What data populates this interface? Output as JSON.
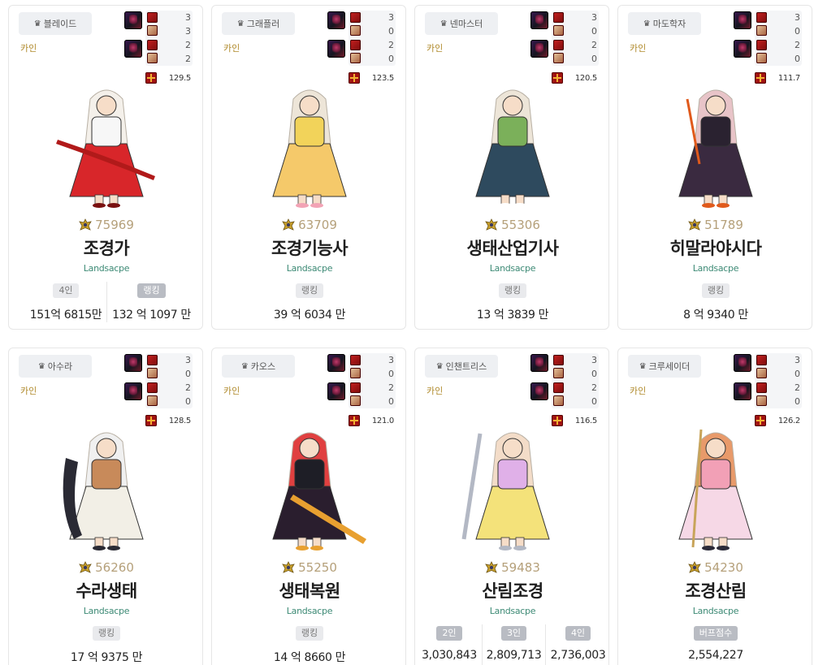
{
  "cards": [
    {
      "class_name": "블레이드",
      "server": "카인",
      "slots": [
        "3",
        "3",
        "2",
        "2"
      ],
      "score": "129.5",
      "fame": "75969",
      "name": "조경가",
      "guild": "Landsacpe",
      "stats": [
        {
          "label": "4인",
          "value": "151억 6815만",
          "style": "light"
        },
        {
          "label": "랭킹",
          "value": "132 억 1097 만",
          "style": "dark"
        }
      ],
      "palette": {
        "hair": "#f4f0ea",
        "top": "#f7f7f7",
        "skirt": "#d8262a",
        "accent": "#7a1010"
      }
    },
    {
      "class_name": "그래플러",
      "server": "카인",
      "slots": [
        "3",
        "0",
        "2",
        "0"
      ],
      "score": "123.5",
      "fame": "63709",
      "name": "조경기능사",
      "guild": "Landsacpe",
      "stats": [
        {
          "label": "랭킹",
          "value": "39 억 6034 만",
          "style": "light"
        }
      ],
      "palette": {
        "hair": "#ede5d8",
        "top": "#f2d35a",
        "skirt": "#f5c96a",
        "accent": "#f2a3b5"
      }
    },
    {
      "class_name": "넨마스터",
      "server": "카인",
      "slots": [
        "3",
        "0",
        "2",
        "0"
      ],
      "score": "120.5",
      "fame": "55306",
      "name": "생태산업기사",
      "guild": "Landsacpe",
      "stats": [
        {
          "label": "랭킹",
          "value": "13 억 3839 만",
          "style": "light"
        }
      ],
      "palette": {
        "hair": "#ede5d8",
        "top": "#7bb05a",
        "skirt": "#2e4a5e",
        "accent": "#ffffff"
      }
    },
    {
      "class_name": "마도학자",
      "server": "카인",
      "slots": [
        "3",
        "0",
        "2",
        "0"
      ],
      "score": "111.7",
      "fame": "51789",
      "name": "히말라야시다",
      "guild": "Landsacpe",
      "stats": [
        {
          "label": "랭킹",
          "value": "8 억 9340 만",
          "style": "light"
        }
      ],
      "palette": {
        "hair": "#e8c4c8",
        "top": "#2a2230",
        "skirt": "#3a2a40",
        "accent": "#e05a1c"
      }
    },
    {
      "class_name": "아수라",
      "server": "카인",
      "slots": [
        "3",
        "0",
        "2",
        "0"
      ],
      "score": "128.5",
      "fame": "56260",
      "name": "수라생태",
      "guild": "Landsacpe",
      "stats": [
        {
          "label": "랭킹",
          "value": "17 억 9375 만",
          "style": "light"
        }
      ],
      "palette": {
        "hair": "#f0f0f0",
        "top": "#c88a5a",
        "skirt": "#f2efe6",
        "accent": "#2a2a34"
      }
    },
    {
      "class_name": "카오스",
      "server": "카인",
      "slots": [
        "3",
        "0",
        "2",
        "0"
      ],
      "score": "121.0",
      "fame": "55250",
      "name": "생태복원",
      "guild": "Landsacpe",
      "stats": [
        {
          "label": "랭킹",
          "value": "14 억 8660 만",
          "style": "light"
        }
      ],
      "palette": {
        "hair": "#e04040",
        "top": "#1e1e26",
        "skirt": "#2a1e2e",
        "accent": "#e8a030"
      }
    },
    {
      "class_name": "인챈트리스",
      "server": "카인",
      "slots": [
        "3",
        "0",
        "2",
        "0"
      ],
      "score": "116.5",
      "fame": "59483",
      "name": "산림조경",
      "guild": "Landsacpe",
      "stats": [
        {
          "label": "2인",
          "value": "3,030,843",
          "style": "dark"
        },
        {
          "label": "3인",
          "value": "2,809,713",
          "style": "dark"
        },
        {
          "label": "4인",
          "value": "2,736,003",
          "style": "dark"
        }
      ],
      "palette": {
        "hair": "#f3dcc8",
        "top": "#e0b0e8",
        "skirt": "#f4e27a",
        "accent": "#b3b8c4"
      }
    },
    {
      "class_name": "크루세이더",
      "server": "카인",
      "slots": [
        "3",
        "0",
        "2",
        "0"
      ],
      "score": "126.2",
      "fame": "54230",
      "name": "조경산림",
      "guild": "Landsacpe",
      "stats": [
        {
          "label": "버프점수",
          "value": "2,554,227",
          "style": "dark"
        }
      ],
      "palette": {
        "hair": "#e89a6a",
        "top": "#f2a0b6",
        "skirt": "#f6d8e6",
        "accent": "#2a2a38"
      }
    }
  ]
}
